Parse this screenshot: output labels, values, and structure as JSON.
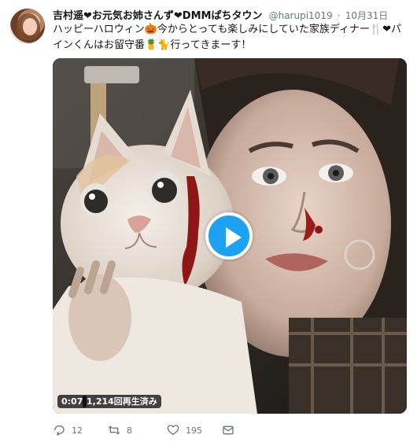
{
  "tweet": {
    "display_name": "吉村遥❤お元気お姉さんず❤DMMぱちタウン",
    "handle": "@harupi1019",
    "separator": "·",
    "timestamp": "10月31日",
    "text": "ハッピーハロウィン🎃今からとっても楽しみにしていた家族ディナー🍴❤パインくんはお留守番🍍🐈行ってきまーす！"
  },
  "video": {
    "duration": "0:07",
    "views": "1,214回再生済み"
  },
  "actions": {
    "reply_count": "12",
    "retweet_count": "8",
    "like_count": "195"
  },
  "colors": {
    "accent": "#1da1f2",
    "muted": "#657786",
    "text": "#14171a"
  },
  "icons": [
    "reply-icon",
    "retweet-icon",
    "like-icon",
    "message-icon",
    "play-icon"
  ]
}
